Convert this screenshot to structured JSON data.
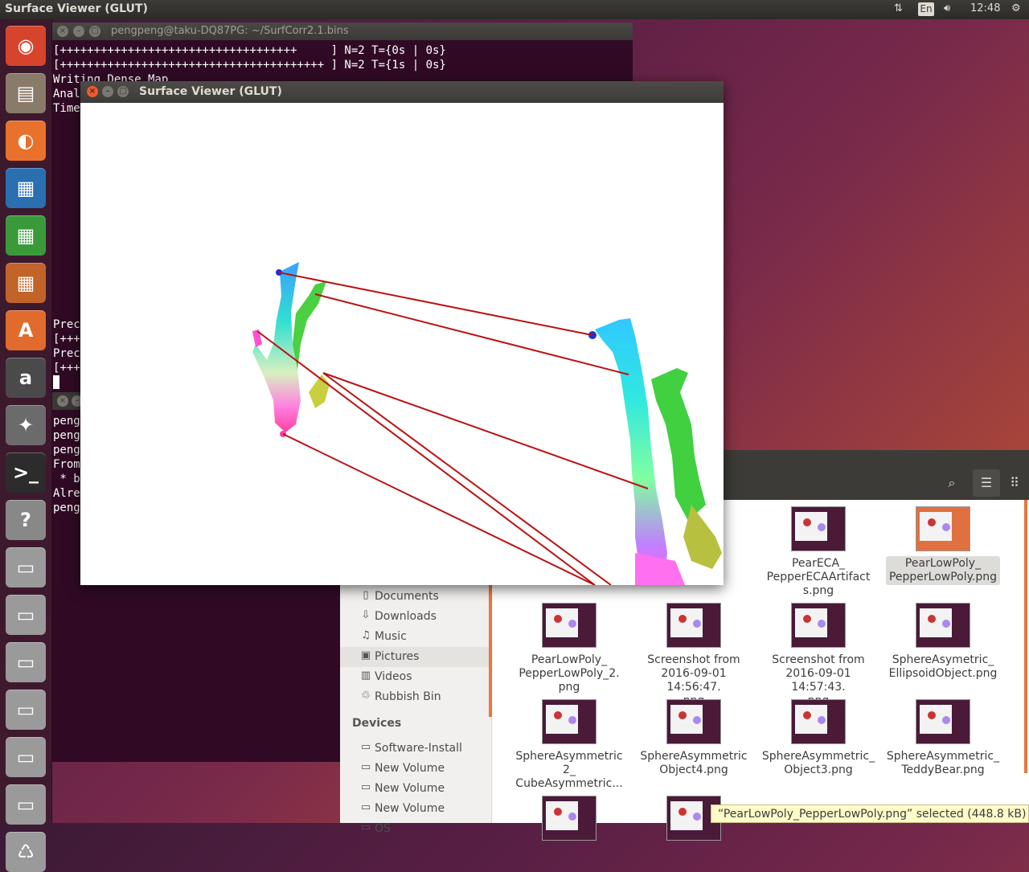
{
  "topbar": {
    "app_title": "Surface Viewer (GLUT)",
    "keyboard_layout": "En",
    "clock": "12:48"
  },
  "launcher": {
    "items": [
      {
        "name": "dash-home-icon",
        "glyph": "◉",
        "color": "#d6442c"
      },
      {
        "name": "file-manager-icon",
        "glyph": "▤",
        "color": "#8a7a6a"
      },
      {
        "name": "firefox-icon",
        "glyph": "◐",
        "color": "#e8722b"
      },
      {
        "name": "libreoffice-writer-icon",
        "glyph": "▦",
        "color": "#2a6fb0"
      },
      {
        "name": "libreoffice-calc-icon",
        "glyph": "▦",
        "color": "#3a9a3a"
      },
      {
        "name": "libreoffice-impress-icon",
        "glyph": "▦",
        "color": "#c2632a"
      },
      {
        "name": "software-center-icon",
        "glyph": "A",
        "color": "#e06b2c"
      },
      {
        "name": "amazon-icon",
        "glyph": "a",
        "color": "#4a4a4a"
      },
      {
        "name": "system-settings-icon",
        "glyph": "✦",
        "color": "#6b6b6b"
      },
      {
        "name": "terminal-icon",
        "glyph": ">_",
        "color": "#2c2c2c"
      },
      {
        "name": "help-icon",
        "glyph": "?",
        "color": "#888888"
      },
      {
        "name": "drive-icon",
        "glyph": "▭",
        "color": "#9a9a9a"
      },
      {
        "name": "drive-icon",
        "glyph": "▭",
        "color": "#9a9a9a"
      },
      {
        "name": "drive-icon",
        "glyph": "▭",
        "color": "#9a9a9a"
      },
      {
        "name": "drive-icon",
        "glyph": "▭",
        "color": "#9a9a9a"
      },
      {
        "name": "drive-icon",
        "glyph": "▭",
        "color": "#9a9a9a"
      },
      {
        "name": "drive-icon",
        "glyph": "▭",
        "color": "#9a9a9a"
      },
      {
        "name": "trash-icon",
        "glyph": "♺",
        "color": "#9a9a9a"
      }
    ]
  },
  "terminal": {
    "title": "pengpeng@taku-DQ87PG: ~/SurfCorr2.1.bins",
    "lines_top": [
      "[+++++++++++++++++++++++++++++++++++     ] N=2 T={0s | 0s}",
      "[+++++++++++++++++++++++++++++++++++++++ ] N=2 T={1s | 0s}",
      "Writing Dense Map",
      "Anal",
      "Time"
    ],
    "lines_mid": [
      "Prec",
      "[+++",
      "Prec",
      "[+++"
    ],
    "lines_bottom": [
      "peng",
      "peng",
      "peng",
      "From",
      " * b",
      "Alre",
      "peng"
    ]
  },
  "viewer": {
    "title": "Surface Viewer (GLUT)"
  },
  "files": {
    "sidebar": [
      {
        "icon": "document-icon",
        "glyph": "▯",
        "label": "Documents"
      },
      {
        "icon": "download-icon",
        "glyph": "⇩",
        "label": "Downloads"
      },
      {
        "icon": "music-icon",
        "glyph": "♫",
        "label": "Music"
      },
      {
        "icon": "pictures-icon",
        "glyph": "▣",
        "label": "Pictures",
        "selected": true
      },
      {
        "icon": "videos-icon",
        "glyph": "▥",
        "label": "Videos"
      },
      {
        "icon": "rubbish-bin-icon",
        "glyph": "♲",
        "label": "Rubbish Bin"
      }
    ],
    "devices_heading": "Devices",
    "devices": [
      {
        "icon": "drive-icon",
        "glyph": "▭",
        "label": "Software-Install"
      },
      {
        "icon": "drive-icon",
        "glyph": "▭",
        "label": "New Volume"
      },
      {
        "icon": "drive-icon",
        "glyph": "▭",
        "label": "New Volume"
      },
      {
        "icon": "drive-icon",
        "glyph": "▭",
        "label": "New Volume"
      },
      {
        "icon": "drive-icon",
        "glyph": "▭",
        "label": "OS"
      }
    ],
    "items": [
      {
        "label": "PearECA_\nPepperECAArtifact\ns.png"
      },
      {
        "label": "PearLowPoly_\nPepperLowPoly.png",
        "selected": true
      },
      {
        "label": "PearLowPoly_\nPepperLowPoly_2.\npng"
      },
      {
        "label": "Screenshot from\n2016-09-01 14:56:47.\npng"
      },
      {
        "label": "Screenshot from\n2016-09-01 14:57:43.\npng"
      },
      {
        "label": "SphereAsymetric_\nEllipsoidObject.png"
      },
      {
        "label": "SphereAsymmetric\n2_\nCubeAsymmetric..."
      },
      {
        "label": "SphereAsymmetric\nObject4.png"
      },
      {
        "label": "SphereAsymmetric_\nObject3.png"
      },
      {
        "label": "SphereAsymmetric_\nTeddyBear.png"
      },
      {
        "label": ""
      },
      {
        "label": ""
      }
    ],
    "status": "“PearLowPoly_PepperLowPoly.png” selected  (448.8 kB)",
    "partial_label": "g"
  }
}
